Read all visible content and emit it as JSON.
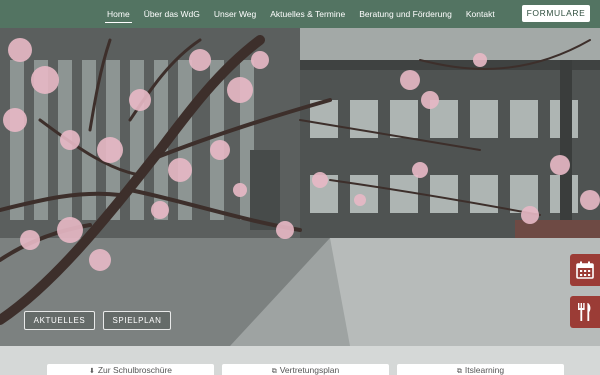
{
  "nav": {
    "items": [
      {
        "label": "Home",
        "active": true
      },
      {
        "label": "Über das WdG",
        "active": false
      },
      {
        "label": "Unser Weg",
        "active": false
      },
      {
        "label": "Aktuelles & Termine",
        "active": false
      },
      {
        "label": "Beratung und Förderung",
        "active": false
      },
      {
        "label": "Kontakt",
        "active": false
      }
    ],
    "formulare_label": "FORMULARE"
  },
  "hero": {
    "buttons": {
      "aktuelles": "AKTUELLES",
      "spielplan": "SPIELPLAN"
    }
  },
  "side_icons": {
    "calendar": "calendar-icon",
    "food": "fork-knife-icon"
  },
  "quick_links": [
    {
      "icon": "download-icon",
      "icon_glyph": "⬇",
      "label": "Zur Schulbroschüre"
    },
    {
      "icon": "external-link-icon",
      "icon_glyph": "⧉",
      "label": "Vertretungsplan"
    },
    {
      "icon": "external-link-icon",
      "icon_glyph": "⧉",
      "label": "Itslearning"
    }
  ],
  "colors": {
    "nav_bg": "#4c705c",
    "accent_red": "#9b3c36",
    "button_text": "#2f4e3e"
  }
}
